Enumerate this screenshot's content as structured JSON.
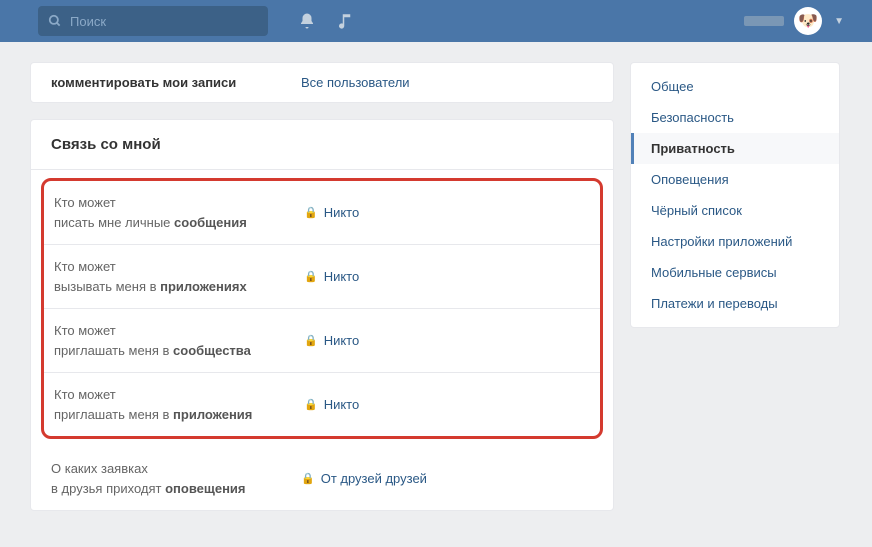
{
  "search": {
    "placeholder": "Поиск"
  },
  "prev_setting": {
    "label": "комментировать мои записи",
    "value": "Все пользователи"
  },
  "section": {
    "title": "Связь со мной"
  },
  "contact_settings": [
    {
      "line1": "Кто может",
      "line2_pre": "писать мне личные ",
      "line2_bold": "сообщения",
      "value": "Никто"
    },
    {
      "line1": "Кто может",
      "line2_pre": "вызывать меня в ",
      "line2_bold": "приложениях",
      "value": "Никто"
    },
    {
      "line1": "Кто может",
      "line2_pre": "приглашать меня в ",
      "line2_bold": "сообщества",
      "value": "Никто"
    },
    {
      "line1": "Кто может",
      "line2_pre": "приглашать меня в ",
      "line2_bold": "приложения",
      "value": "Никто"
    }
  ],
  "outside_setting": {
    "line1": "О каких заявках",
    "line2_pre": "в друзья приходят ",
    "line2_bold": "оповещения",
    "value": "От друзей друзей"
  },
  "sidebar": {
    "items": [
      {
        "label": "Общее"
      },
      {
        "label": "Безопасность"
      },
      {
        "label": "Приватность"
      },
      {
        "label": "Оповещения"
      },
      {
        "label": "Чёрный список"
      },
      {
        "label": "Настройки приложений"
      },
      {
        "label": "Мобильные сервисы"
      },
      {
        "label": "Платежи и переводы"
      }
    ],
    "active_index": 2
  }
}
